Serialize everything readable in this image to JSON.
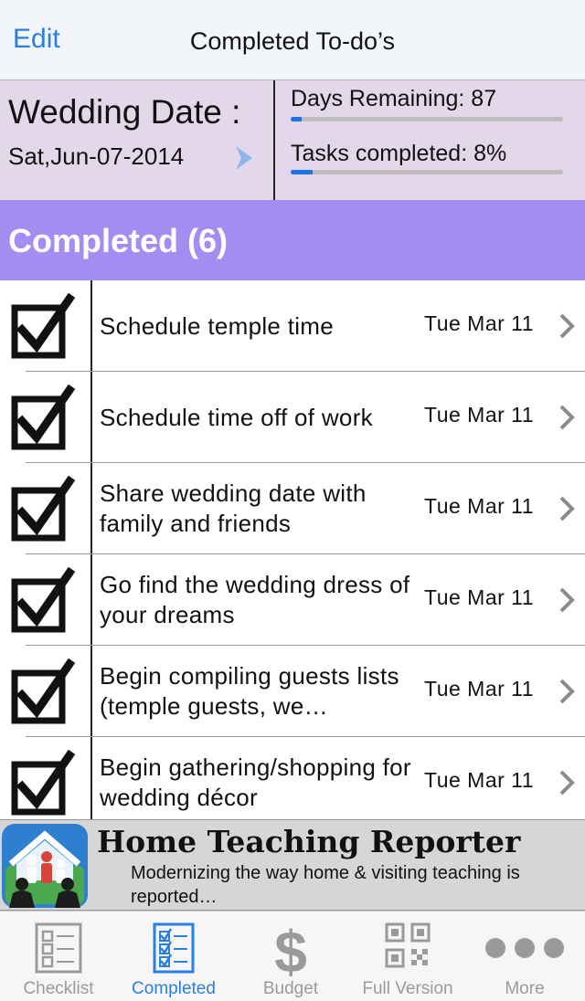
{
  "navbar": {
    "edit_label": "Edit",
    "title": "Completed To-do’s"
  },
  "summary": {
    "wedding_label": "Wedding Date :",
    "wedding_date": "Sat,Jun-07-2014",
    "days_remaining_label": "Days Remaining:  87",
    "days_remaining_progress": 0.04,
    "tasks_completed_label": "Tasks completed: 8%",
    "tasks_completed_progress": 0.08
  },
  "section": {
    "title": "Completed (6)"
  },
  "tasks": [
    {
      "text": "Schedule temple time",
      "date": "Tue Mar 11",
      "checked": true
    },
    {
      "text": "Schedule time off of work",
      "date": "Tue Mar 11",
      "checked": true
    },
    {
      "text": "Share wedding date with family and friends",
      "date": "Tue Mar 11",
      "checked": true
    },
    {
      "text": "Go find the wedding dress of your dreams",
      "date": "Tue Mar 11",
      "checked": true
    },
    {
      "text": "Begin compiling guests lists (temple guests, we…",
      "date": "Tue Mar 11",
      "checked": true
    },
    {
      "text": "Begin gathering/shopping for wedding décor",
      "date": "Tue Mar 11",
      "checked": true
    }
  ],
  "ad": {
    "title": "Home Teaching Reporter",
    "description": "Modernizing the way home & visiting teaching is reported…",
    "icon": "family-house-app-icon"
  },
  "tabs": [
    {
      "label": "Checklist",
      "icon": "checklist-icon",
      "active": false
    },
    {
      "label": "Completed",
      "icon": "completed-checklist-icon",
      "active": true
    },
    {
      "label": "Budget",
      "icon": "dollar-icon",
      "active": false
    },
    {
      "label": "Full Version",
      "icon": "qr-code-icon",
      "active": false
    },
    {
      "label": "More",
      "icon": "more-dots-icon",
      "active": false
    }
  ],
  "colors": {
    "accent": "#2b7fe0",
    "summary_bg": "#e3d8e9",
    "section_bg": "#a48df0",
    "tab_inactive": "#9a9a9a"
  }
}
